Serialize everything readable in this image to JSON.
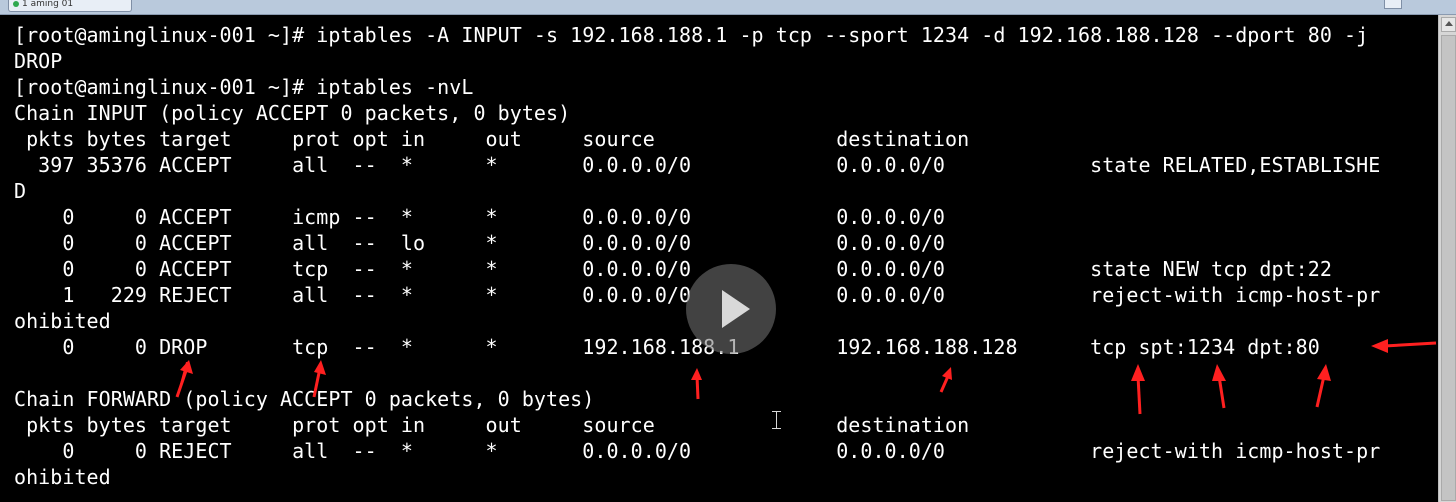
{
  "window": {
    "tab_title": "1 aming 01"
  },
  "terminal": {
    "lines": [
      "[root@aminglinux-001 ~]# iptables -A INPUT -s 192.168.188.1 -p tcp --sport 1234 -d 192.168.188.128 --dport 80 -j",
      "DROP",
      "[root@aminglinux-001 ~]# iptables -nvL",
      "Chain INPUT (policy ACCEPT 0 packets, 0 bytes)",
      " pkts bytes target     prot opt in     out     source               destination",
      "  397 35376 ACCEPT     all  --  *      *       0.0.0.0/0            0.0.0.0/0            state RELATED,ESTABLISHE",
      "D",
      "    0     0 ACCEPT     icmp --  *      *       0.0.0.0/0            0.0.0.0/0",
      "    0     0 ACCEPT     all  --  lo     *       0.0.0.0/0            0.0.0.0/0",
      "    0     0 ACCEPT     tcp  --  *      *       0.0.0.0/0            0.0.0.0/0            state NEW tcp dpt:22",
      "    1   229 REJECT     all  --  *      *       0.0.0.0/0            0.0.0.0/0            reject-with icmp-host-pr",
      "ohibited",
      "    0     0 DROP       tcp  --  *      *       192.168.188.1        192.168.188.128      tcp spt:1234 dpt:80",
      "",
      "Chain FORWARD (policy ACCEPT 0 packets, 0 bytes)",
      " pkts bytes target     prot opt in     out     source               destination",
      "    0     0 REJECT     all  --  *      *       0.0.0.0/0            0.0.0.0/0            reject-with icmp-host-pr",
      "ohibited"
    ]
  },
  "annotation": {
    "arrow_color": "#ff2020"
  },
  "icons": {
    "play": "play-icon",
    "cursor": "text-cursor-icon"
  }
}
